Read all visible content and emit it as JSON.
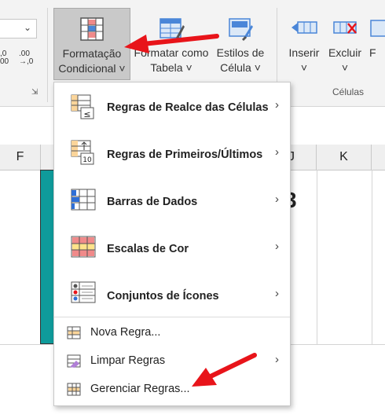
{
  "ribbon": {
    "font_select": {
      "value": ""
    },
    "decimal_buttons": [
      {
        "top": ",0",
        "bottom": "00"
      },
      {
        "top": ".00",
        "bottom": "→,0"
      }
    ],
    "buttons": {
      "conditional_formatting": {
        "line1": "Formatação",
        "line2": "Condicional ˅"
      },
      "format_as_table": {
        "line1": "Formatar como",
        "line2": "Tabela ˅"
      },
      "cell_styles": {
        "line1": "Estilos de",
        "line2": "Célula ˅"
      },
      "insert": {
        "line1": "Inserir",
        "line2": "˅"
      },
      "delete": {
        "line1": "Excluir",
        "line2": "˅"
      },
      "format": {
        "line1": "F"
      }
    },
    "cells_group_label": "Células"
  },
  "sheet": {
    "columns": [
      "F",
      "J",
      "K"
    ],
    "visible_value": "3"
  },
  "menu": {
    "items": [
      {
        "label": "Regras de Realce das Células",
        "has_submenu": true
      },
      {
        "label": "Regras de Primeiros/Últimos",
        "has_submenu": true
      },
      {
        "label": "Barras de Dados",
        "has_submenu": true
      },
      {
        "label": "Escalas de Cor",
        "has_submenu": true
      },
      {
        "label": "Conjuntos de Ícones",
        "has_submenu": true
      }
    ],
    "actions": [
      {
        "label": "Nova Regra...",
        "has_submenu": false
      },
      {
        "label": "Limpar Regras",
        "has_submenu": true
      },
      {
        "label": "Gerenciar Regras...",
        "has_submenu": false
      }
    ],
    "submenu_arrow": "›",
    "icon_texts": {
      "less_than": "≤",
      "top_ten": "10"
    }
  },
  "colors": {
    "annotation_arrow": "#e8141a",
    "teal_fill": "#0f9b9b",
    "active_button": "#c9c9c9"
  }
}
